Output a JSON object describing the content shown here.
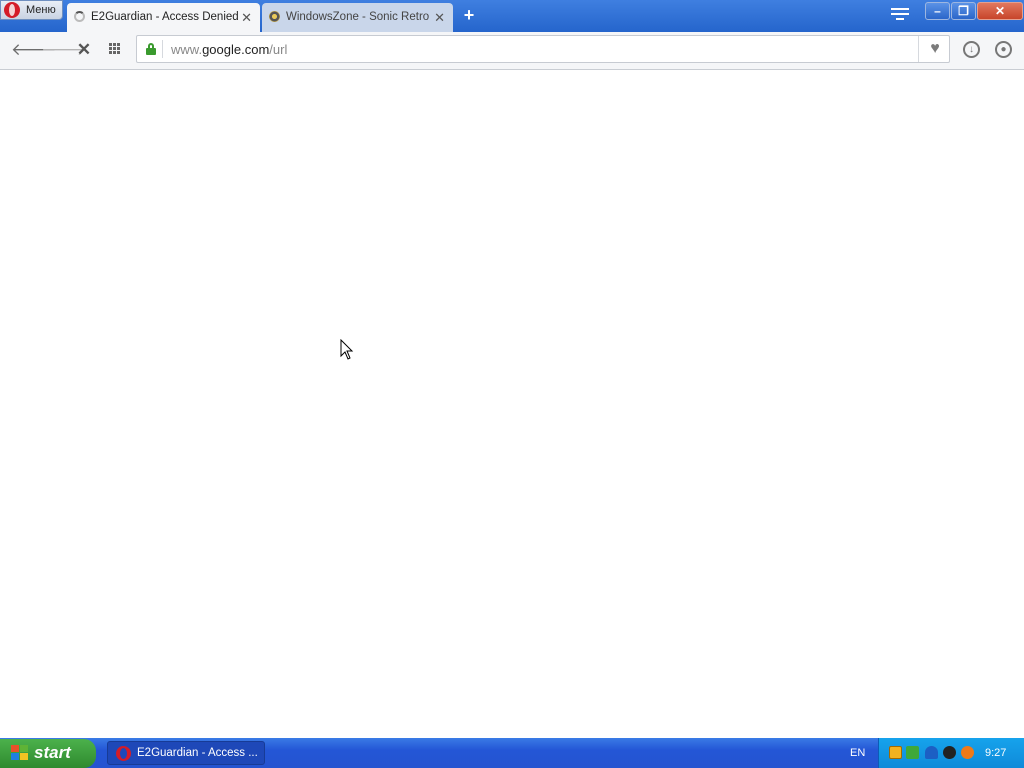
{
  "browser": {
    "menu_label": "Меню",
    "tabs": [
      {
        "title": "E2Guardian - Access Denied",
        "state": "loading",
        "active": true
      },
      {
        "title": "WindowsZone - Sonic Retro",
        "state": "loaded",
        "active": false
      }
    ],
    "address": {
      "prefix": "www.",
      "domain": "google.com",
      "path": "/url",
      "secure": true
    },
    "icons": {
      "back": "arrow-left-icon",
      "forward": "arrow-right-icon",
      "stop": "close-icon",
      "speed_dial": "grid-icon",
      "bookmark": "heart-icon",
      "downloads": "download-icon",
      "account": "user-icon"
    }
  },
  "taskbar": {
    "start_label": "start",
    "items": [
      {
        "label": "E2Guardian - Access ..."
      }
    ],
    "language": "EN",
    "clock": "9:27"
  },
  "colors": {
    "title_bar": "#2565cc",
    "taskbar": "#2456d6",
    "start_button": "#3a9c3a",
    "tray": "#0f8ad9",
    "secure_lock": "#3a9a2e"
  }
}
